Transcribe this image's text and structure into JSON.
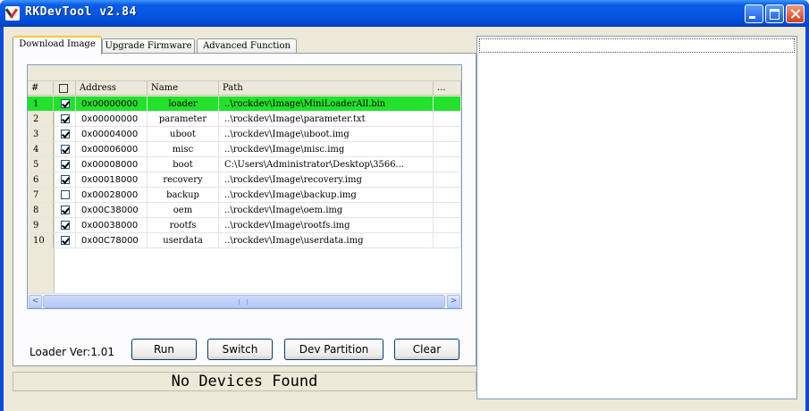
{
  "window": {
    "title": "RKDevTool v2.84"
  },
  "tabs": [
    {
      "label": "Download Image"
    },
    {
      "label": "Upgrade Firmware"
    },
    {
      "label": "Advanced Function"
    }
  ],
  "table": {
    "headers": {
      "index": "#",
      "address": "Address",
      "name": "Name",
      "path": "Path",
      "more": "..."
    },
    "rows": [
      {
        "index": "1",
        "checked": true,
        "address": "0x00000000",
        "name": "loader",
        "path": "..\\rockdev\\Image\\MiniLoaderAll.bin",
        "selected": true
      },
      {
        "index": "2",
        "checked": true,
        "address": "0x00000000",
        "name": "parameter",
        "path": "..\\rockdev\\Image\\parameter.txt"
      },
      {
        "index": "3",
        "checked": true,
        "address": "0x00004000",
        "name": "uboot",
        "path": "..\\rockdev\\Image\\uboot.img"
      },
      {
        "index": "4",
        "checked": true,
        "address": "0x00006000",
        "name": "misc",
        "path": "..\\rockdev\\Image\\misc.img"
      },
      {
        "index": "5",
        "checked": true,
        "address": "0x00008000",
        "name": "boot",
        "path": "C:\\Users\\Administrator\\Desktop\\3566..."
      },
      {
        "index": "6",
        "checked": true,
        "address": "0x00018000",
        "name": "recovery",
        "path": "..\\rockdev\\Image\\recovery.img"
      },
      {
        "index": "7",
        "checked": false,
        "address": "0x00028000",
        "name": "backup",
        "path": "..\\rockdev\\Image\\backup.img"
      },
      {
        "index": "8",
        "checked": true,
        "address": "0x00C38000",
        "name": "oem",
        "path": "..\\rockdev\\Image\\oem.img"
      },
      {
        "index": "9",
        "checked": true,
        "address": "0x00038000",
        "name": "rootfs",
        "path": "..\\rockdev\\Image\\rootfs.img"
      },
      {
        "index": "10",
        "checked": true,
        "address": "0x00C78000",
        "name": "userdata",
        "path": "..\\rockdev\\Image\\userdata.img"
      }
    ]
  },
  "scrollbar": {
    "left_arrow": "<",
    "right_arrow": ">"
  },
  "loader_version": "Loader Ver:1.01",
  "buttons": {
    "run": "Run",
    "switch": "Switch",
    "dev_partition": "Dev Partition",
    "clear": "Clear"
  },
  "status": "No Devices Found",
  "colors": {
    "selected_row": "#22E22B",
    "titlebar": "#0A5DE8"
  }
}
